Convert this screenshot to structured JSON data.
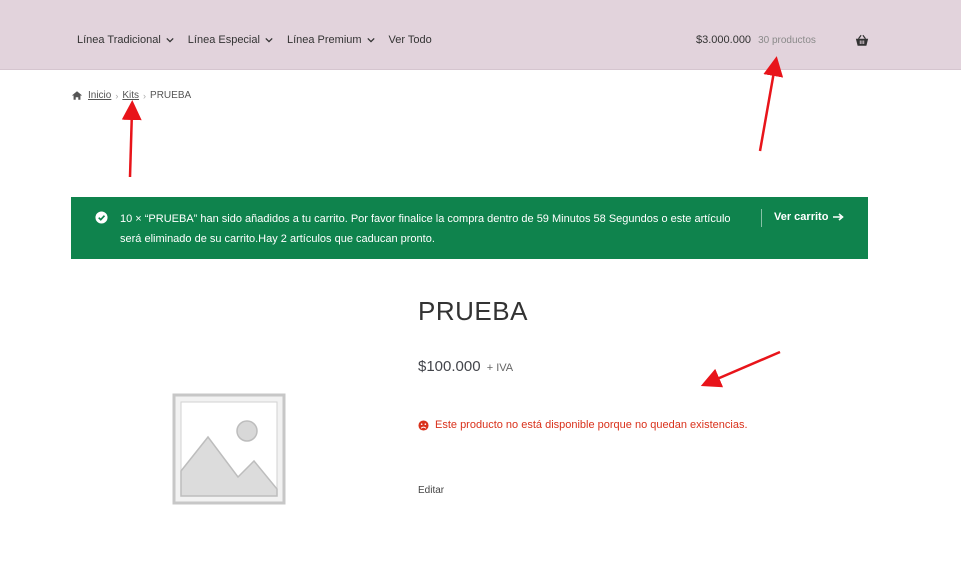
{
  "nav": {
    "items": [
      {
        "label": "Línea Tradicional",
        "has_dropdown": true
      },
      {
        "label": "Línea Especial",
        "has_dropdown": true
      },
      {
        "label": "Línea Premium",
        "has_dropdown": true
      },
      {
        "label": "Ver Todo",
        "has_dropdown": false
      }
    ]
  },
  "cart": {
    "total": "$3.000.000",
    "count": "30 productos",
    "icon": "basket-icon"
  },
  "breadcrumb": {
    "home": "Inicio",
    "category": "Kits",
    "current": "PRUEBA"
  },
  "notice": {
    "line1": "10 × “PRUEBA” han sido añadidos a tu carrito. Por favor finalice la compra dentro de 59 Minutos 58 Segundos o este artículo",
    "line2": "será eliminado de su carrito.Hay 2 artículos que caducan pronto.",
    "view_cart": "Ver carrito",
    "color": "#0f834d"
  },
  "product": {
    "title": "PRUEBA",
    "price": "$100.000",
    "price_suffix": "+ IVA",
    "stock_message": "Este producto no está disponible porque no quedan existencias.",
    "edit_label": "Editar"
  },
  "colors": {
    "header_bg": "#e2d3dc",
    "error": "#d9311b",
    "annotation_arrow": "#e8141a"
  }
}
